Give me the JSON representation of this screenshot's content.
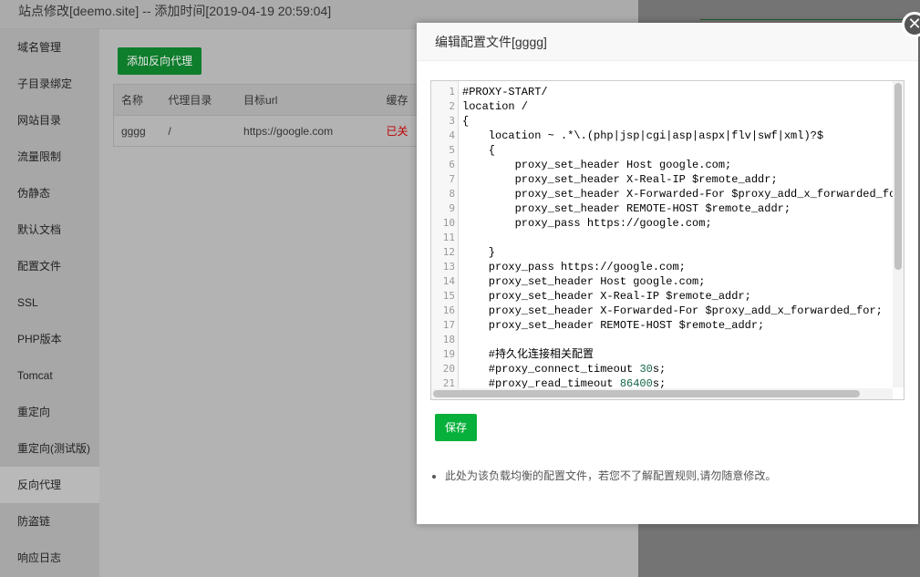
{
  "title": "站点修改[deemo.site] -- 添加时间[2019-04-19 20:59:04]",
  "sidebar": {
    "items": [
      "域名管理",
      "子目录绑定",
      "网站目录",
      "流量限制",
      "伪静态",
      "默认文档",
      "配置文件",
      "SSL",
      "PHP版本",
      "Tomcat",
      "重定向",
      "重定向(测试版)",
      "反向代理",
      "防盗链",
      "响应日志"
    ],
    "active": "反向代理"
  },
  "content": {
    "add_button": "添加反向代理",
    "table": {
      "headers": [
        "名称",
        "代理目录",
        "目标url",
        "缓存"
      ],
      "rows": [
        [
          "gggg",
          "/",
          "https://google.com",
          "已关"
        ]
      ]
    }
  },
  "modal": {
    "title": "编辑配置文件[gggg]",
    "close_icon": "close-icon",
    "code_lines": [
      "#PROXY-START/",
      "location /",
      "{",
      "    location ~ .*\\.(php|jsp|cgi|asp|aspx|flv|swf|xml)?$",
      "    {",
      "        proxy_set_header Host google.com;",
      "        proxy_set_header X-Real-IP $remote_addr;",
      "        proxy_set_header X-Forwarded-For $proxy_add_x_forwarded_fo",
      "        proxy_set_header REMOTE-HOST $remote_addr;",
      "        proxy_pass https://google.com;",
      "",
      "    }",
      "    proxy_pass https://google.com;",
      "    proxy_set_header Host google.com;",
      "    proxy_set_header X-Real-IP $remote_addr;",
      "    proxy_set_header X-Forwarded-For $proxy_add_x_forwarded_for;",
      "    proxy_set_header REMOTE-HOST $remote_addr;",
      "",
      "    #持久化连接相关配置",
      "    #proxy_connect_timeout 30s;",
      "    #proxy_read_timeout 86400s;"
    ],
    "save_button": "保存",
    "note": "此处为该负载均衡的配置文件，若您不了解配置规则,请勿随意修改。"
  },
  "colors": {
    "primary_green": "#07b03b",
    "status_red": "#c00000"
  }
}
